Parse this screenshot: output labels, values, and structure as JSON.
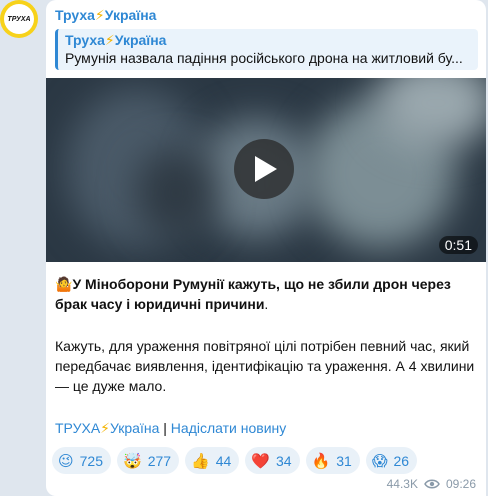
{
  "channel": {
    "avatar_text": "ТРУХА",
    "name_part1": "Труха",
    "bolt": "⚡",
    "name_part2": "Україна"
  },
  "reply": {
    "title_part1": "Труха",
    "title_part2": "Україна",
    "text": "Румунія назвала падіння російського дрона на житловий бу..."
  },
  "video": {
    "duration": "0:51",
    "icon": "play-icon"
  },
  "message": {
    "lead_emoji": "🤷",
    "lead": "У Міноборони Румунії кажуть, що не збили дрон через брак часу і юридичні причини",
    "lead_end": ".",
    "body": "Кажуть, для ураження повітряної цілі потрібен певний час, який передбачає виявлення, ідентифікацію та ураження. А 4 хвилини — це дуже мало."
  },
  "links": {
    "channel_part1": "ТРУХА",
    "channel_part2": "Україна",
    "separator": " | ",
    "submit": "Надіслати новину"
  },
  "reactions": [
    {
      "emoji": "😉",
      "count": "725"
    },
    {
      "emoji": "🤯",
      "count": "277"
    },
    {
      "emoji": "👍",
      "count": "44"
    },
    {
      "emoji": "❤️",
      "count": "34"
    },
    {
      "emoji": "🔥",
      "count": "31"
    },
    {
      "emoji": "😱",
      "count": "26"
    }
  ],
  "meta": {
    "views": "44.3K",
    "views_icon": "eye-icon",
    "time": "09:26"
  },
  "colors": {
    "accent": "#2f88d4",
    "bolt": "#f4b400",
    "avatar_ring": "#f7d21a"
  }
}
